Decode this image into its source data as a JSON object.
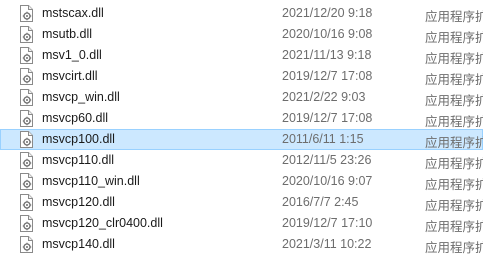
{
  "files": [
    {
      "name": "mstscax.dll",
      "date": "2021/12/20 9:18",
      "type": "应用程序扩"
    },
    {
      "name": "msutb.dll",
      "date": "2020/10/16 9:08",
      "type": "应用程序扩"
    },
    {
      "name": "msv1_0.dll",
      "date": "2021/11/13 9:18",
      "type": "应用程序扩"
    },
    {
      "name": "msvcirt.dll",
      "date": "2019/12/7 17:08",
      "type": "应用程序扩"
    },
    {
      "name": "msvcp_win.dll",
      "date": "2021/2/22 9:03",
      "type": "应用程序扩"
    },
    {
      "name": "msvcp60.dll",
      "date": "2019/12/7 17:08",
      "type": "应用程序扩"
    },
    {
      "name": "msvcp100.dll",
      "date": "2011/6/11 1:15",
      "type": "应用程序扩",
      "selected": true
    },
    {
      "name": "msvcp110.dll",
      "date": "2012/11/5 23:26",
      "type": "应用程序扩"
    },
    {
      "name": "msvcp110_win.dll",
      "date": "2020/10/16 9:07",
      "type": "应用程序扩"
    },
    {
      "name": "msvcp120.dll",
      "date": "2016/7/7 2:45",
      "type": "应用程序扩"
    },
    {
      "name": "msvcp120_clr0400.dll",
      "date": "2019/12/7 17:10",
      "type": "应用程序扩"
    },
    {
      "name": "msvcp140.dll",
      "date": "2021/3/11 10:22",
      "type": "应用程序扩"
    }
  ],
  "icon": "dll-file-icon"
}
